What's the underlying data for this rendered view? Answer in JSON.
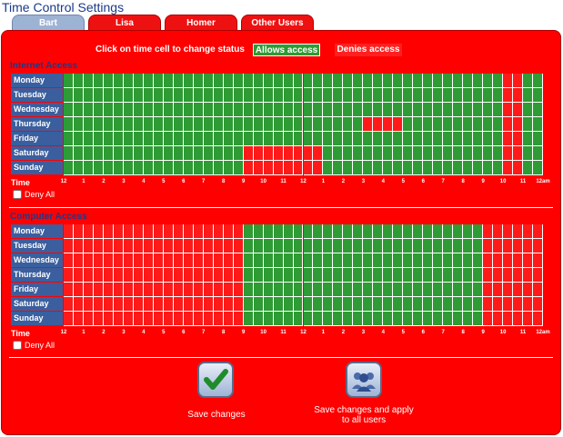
{
  "page_title": "Time Control Settings",
  "tabs": [
    {
      "label": "Bart",
      "active": true
    },
    {
      "label": "Lisa",
      "active": false
    },
    {
      "label": "Homer",
      "active": false
    },
    {
      "label": "Other Users",
      "active": false
    }
  ],
  "legend": {
    "instruction": "Click on time cell to change status",
    "allow_label": "Allows access",
    "deny_label": "Denies access"
  },
  "colors": {
    "allow": "#2e9b34",
    "deny": "#ff1a1a",
    "panel": "#ff0000",
    "day_bg": "#3b5f9e"
  },
  "days": [
    "Monday",
    "Tuesday",
    "Wednesday",
    "Thursday",
    "Friday",
    "Saturday",
    "Sunday"
  ],
  "time_label": "Time",
  "ticks": [
    "12",
    "1",
    "2",
    "3",
    "4",
    "5",
    "6",
    "7",
    "8",
    "9",
    "10",
    "11",
    "12",
    "1",
    "2",
    "3",
    "4",
    "5",
    "6",
    "7",
    "8",
    "9",
    "10",
    "11",
    "12am"
  ],
  "deny_all_label": "Deny All",
  "internet_access": {
    "title": "Internet Access",
    "deny_ranges": [
      [
        [
          44,
          46
        ]
      ],
      [
        [
          44,
          46
        ]
      ],
      [
        [
          44,
          46
        ]
      ],
      [
        [
          30,
          34
        ],
        [
          44,
          46
        ]
      ],
      [
        [
          44,
          46
        ]
      ],
      [
        [
          18,
          26
        ],
        [
          44,
          46
        ]
      ],
      [
        [
          18,
          26
        ],
        [
          44,
          46
        ]
      ]
    ]
  },
  "computer_access": {
    "title": "Computer Access",
    "deny_ranges": [
      [
        [
          0,
          18
        ],
        [
          42,
          48
        ]
      ],
      [
        [
          0,
          18
        ],
        [
          42,
          48
        ]
      ],
      [
        [
          0,
          18
        ],
        [
          42,
          48
        ]
      ],
      [
        [
          0,
          18
        ],
        [
          42,
          48
        ]
      ],
      [
        [
          0,
          18
        ],
        [
          42,
          48
        ]
      ],
      [
        [
          0,
          18
        ],
        [
          42,
          48
        ]
      ],
      [
        [
          0,
          18
        ],
        [
          42,
          48
        ]
      ]
    ]
  },
  "buttons": {
    "save": "Save changes",
    "save_all": "Save changes and apply to all users"
  }
}
